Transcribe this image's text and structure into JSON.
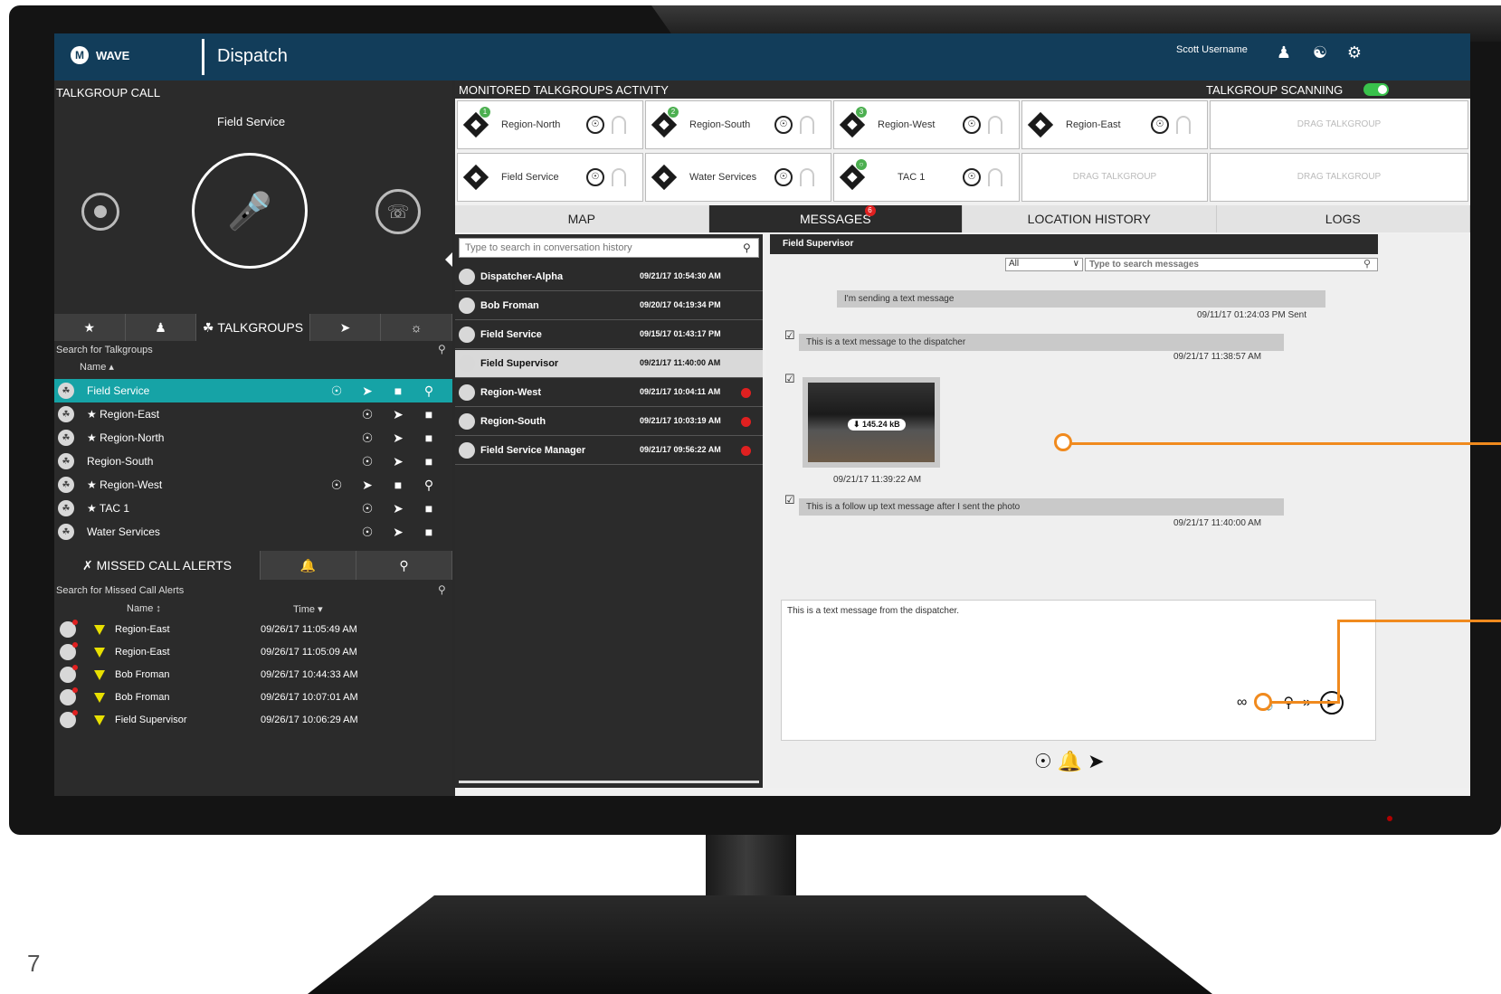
{
  "header": {
    "brand": "WAVE",
    "app_title": "Dispatch",
    "user_name": "Scott Username",
    "icons": [
      "user-status-icon",
      "dispatch-icon",
      "gear-icon"
    ]
  },
  "left": {
    "talkgroup_call_label": "TALKGROUP CALL",
    "current_talkgroup": "Field Service",
    "tabs": {
      "active_label": "TALKGROUPS"
    },
    "search_label": "Search for Talkgroups",
    "sort_label": "Name ▴",
    "talkgroups": [
      {
        "name": "Field Service",
        "star": ""
      },
      {
        "name": "Region-East",
        "star": "★"
      },
      {
        "name": "Region-North",
        "star": "★"
      },
      {
        "name": "Region-South",
        "star": ""
      },
      {
        "name": "Region-West",
        "star": "★"
      },
      {
        "name": "TAC 1",
        "star": "★"
      },
      {
        "name": "Water Services",
        "star": ""
      }
    ],
    "alerts_tab_label": "MISSED CALL ALERTS",
    "alerts_search_label": "Search for Missed Call Alerts",
    "alerts_col_name": "Name ↕",
    "alerts_col_time": "Time ▾",
    "alerts": [
      {
        "name": "Region-East",
        "time": "09/26/17 11:05:49 AM"
      },
      {
        "name": "Region-East",
        "time": "09/26/17 11:05:09 AM"
      },
      {
        "name": "Bob Froman",
        "time": "09/26/17 10:44:33 AM"
      },
      {
        "name": "Bob Froman",
        "time": "09/26/17 10:07:01 AM"
      },
      {
        "name": "Field Supervisor",
        "time": "09/26/17 10:06:29 AM"
      }
    ]
  },
  "monitor": {
    "title": "MONITORED TALKGROUPS ACTIVITY",
    "scanning_label": "TALKGROUP SCANNING",
    "drag_label": "DRAG TALKGROUP",
    "cards": [
      {
        "name": "Region-North",
        "badge": "1"
      },
      {
        "name": "Region-South",
        "badge": "2"
      },
      {
        "name": "Region-West",
        "badge": "3"
      },
      {
        "name": "Region-East",
        "badge": ""
      },
      {
        "name": "Field Service",
        "badge": ""
      },
      {
        "name": "Water Services",
        "badge": ""
      },
      {
        "name": "TAC 1",
        "badge": "○"
      }
    ]
  },
  "tabs": {
    "map": "MAP",
    "messages": "MESSAGES",
    "messages_badge": "6",
    "location_history": "LOCATION HISTORY",
    "logs": "LOGS"
  },
  "conversations": {
    "search_placeholder": "Type to search in conversation history",
    "items": [
      {
        "name": "Dispatcher-Alpha",
        "time": "09/21/17 10:54:30 AM",
        "badge": false
      },
      {
        "name": "Bob Froman",
        "time": "09/20/17 04:19:34 PM",
        "badge": false
      },
      {
        "name": "Field Service",
        "time": "09/15/17 01:43:17 PM",
        "badge": false
      },
      {
        "name": "Field Supervisor",
        "time": "09/21/17 11:40:00 AM",
        "badge": false
      },
      {
        "name": "Region-West",
        "time": "09/21/17 10:04:11 AM",
        "badge": true
      },
      {
        "name": "Region-South",
        "time": "09/21/17 10:03:19 AM",
        "badge": true
      },
      {
        "name": "Field Service Manager",
        "time": "09/21/17 09:56:22 AM",
        "badge": true
      }
    ]
  },
  "messages": {
    "contact": "Field Supervisor",
    "filter_value": "All",
    "search_placeholder": "Type to search messages",
    "sent_text": "I'm sending a text message",
    "sent_meta": "09/11/17 01:24:03 PM Sent",
    "recv1_text": "This is a text message to the dispatcher",
    "recv1_time": "09/21/17 11:38:57 AM",
    "photo_size": "⬇ 145.24 kB",
    "photo_time": "09/21/17 11:39:22 AM",
    "recv2_text": "This is a follow up text message after I sent the photo",
    "recv2_time": "09/21/17 11:40:00 AM",
    "compose_text": "This is a text message from the dispatcher."
  },
  "page_number": "7",
  "colors": {
    "header": "#123d5a",
    "selected_row": "#16a3a6",
    "callout": "#f08a1e",
    "badge": "#e02020"
  }
}
